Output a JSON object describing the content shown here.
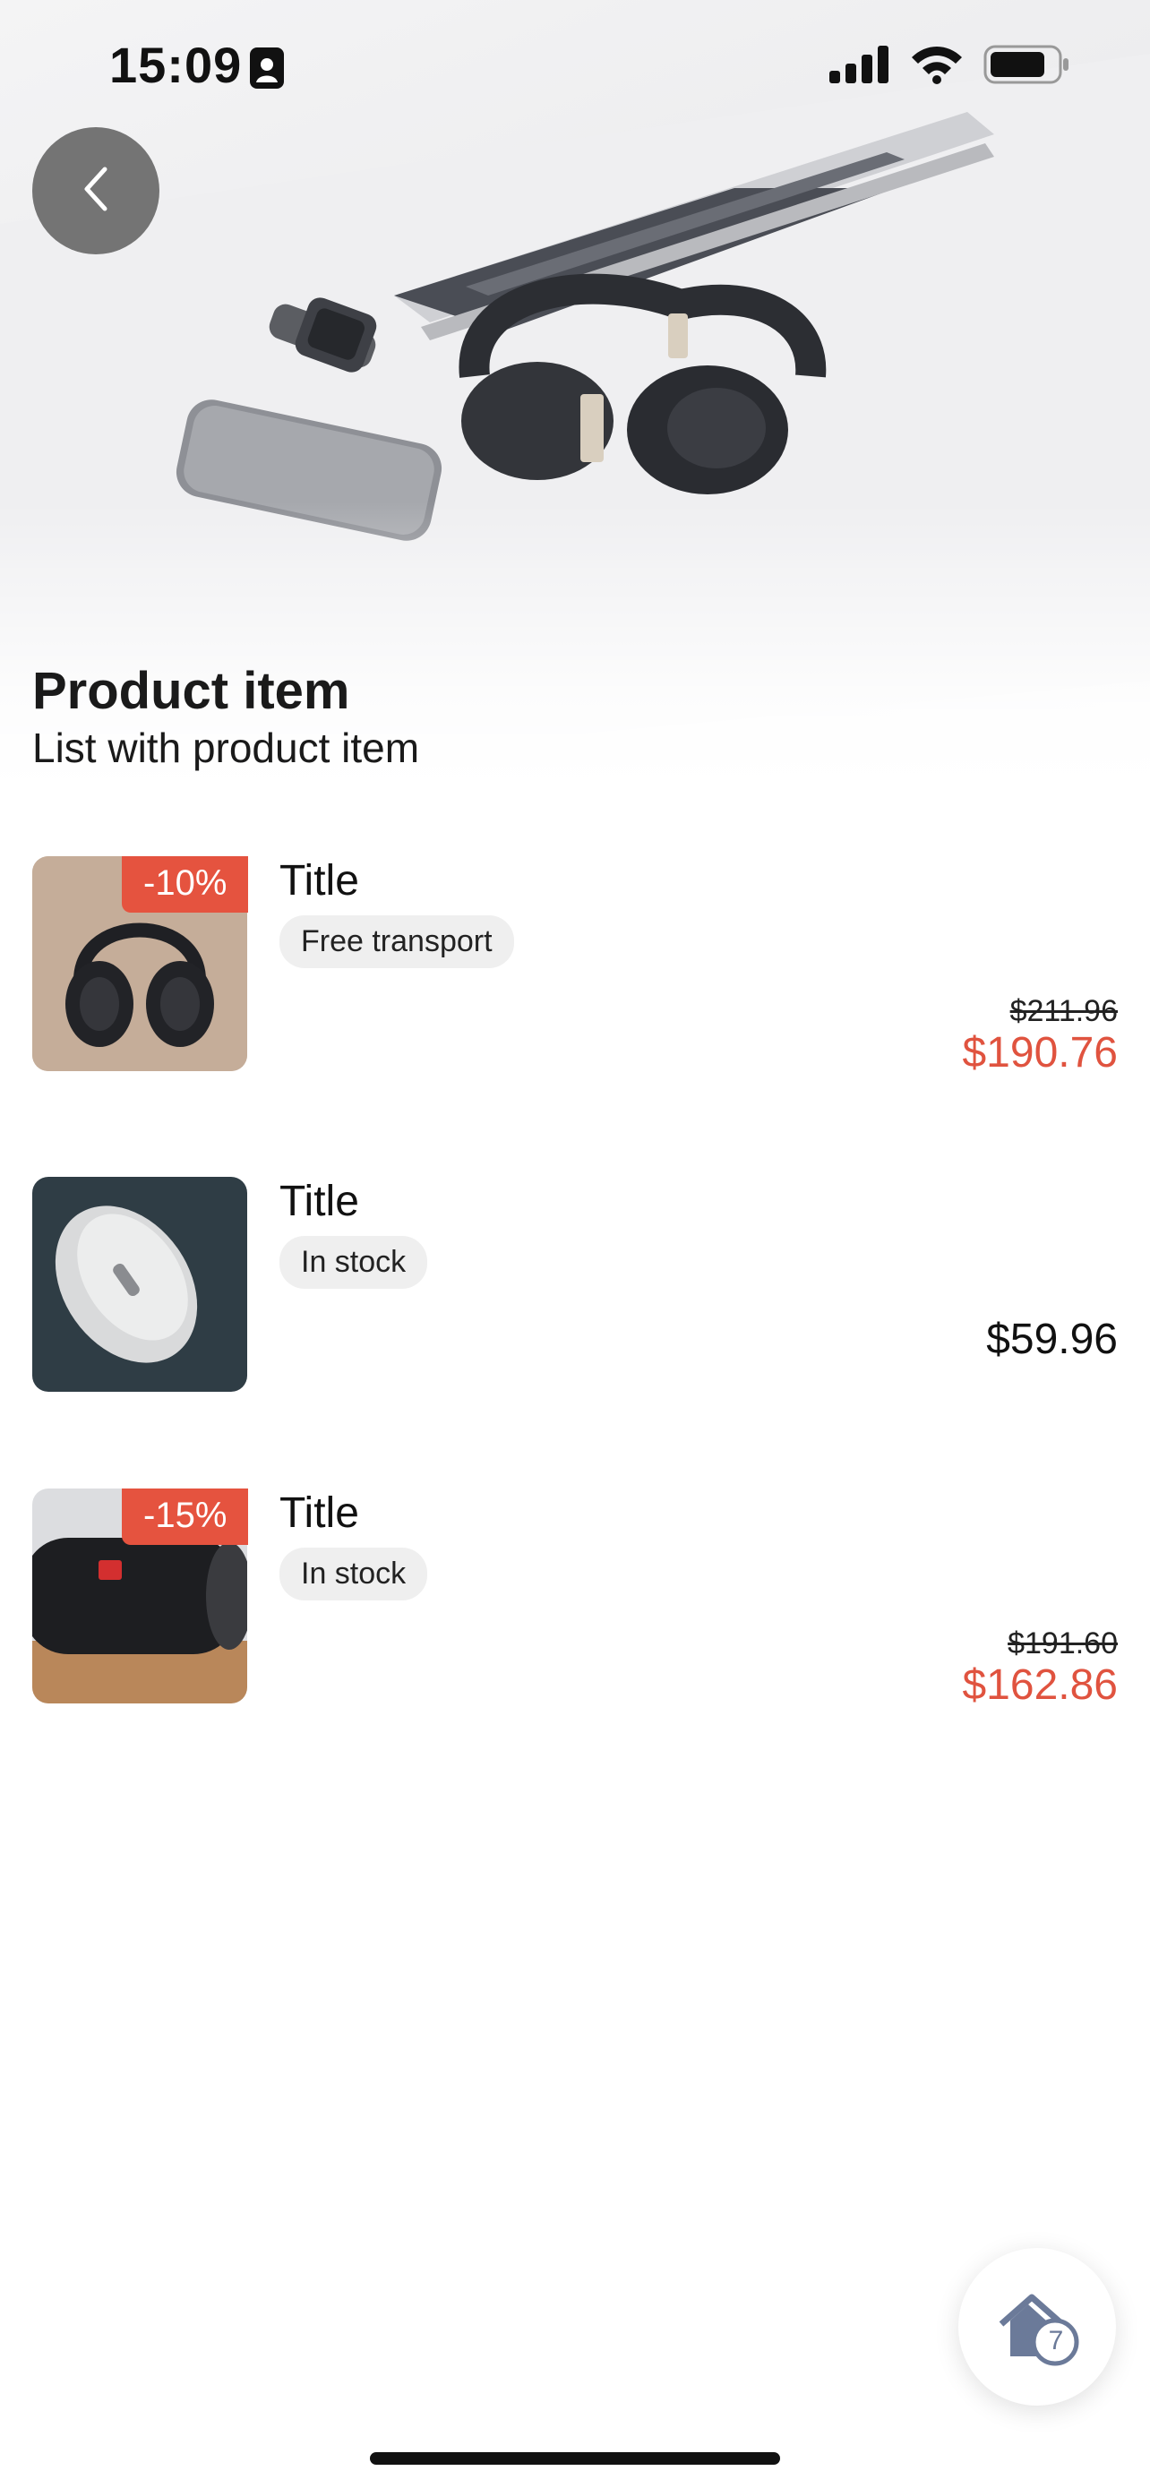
{
  "status": {
    "time": "15:09"
  },
  "header": {
    "title": "Product item",
    "subtitle": "List with product item"
  },
  "products": [
    {
      "title": "Title",
      "chip": "Free transport",
      "discount": "-10%",
      "old_price": "$211.96",
      "price": "$190.76",
      "image": "headphones"
    },
    {
      "title": "Title",
      "chip": "In stock",
      "price": "$59.96",
      "image": "mouse"
    },
    {
      "title": "Title",
      "chip": "In stock",
      "discount": "-15%",
      "old_price": "$191.60",
      "price": "$162.86",
      "image": "speaker"
    }
  ],
  "fab": {
    "badge": "7",
    "icon": "home-icon"
  },
  "colors": {
    "accent": "#e5533f",
    "chip_bg": "#efefef",
    "fab_icon": "#6b7a99"
  }
}
